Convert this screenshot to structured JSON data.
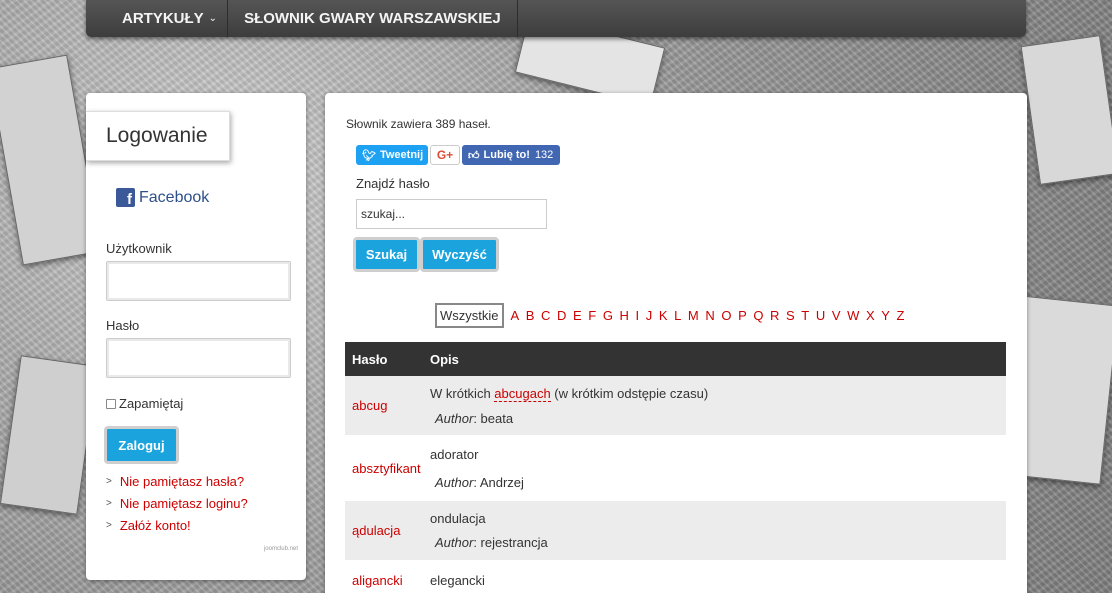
{
  "nav": {
    "items": [
      {
        "label": "ARTYKUŁY",
        "caret": "⌄"
      },
      {
        "label": "SŁOWNIK GWARY WARSZAWSKIEJ"
      }
    ]
  },
  "sidebar": {
    "title": "Logowanie",
    "facebook_label": "Facebook",
    "username_label": "Użytkownik",
    "password_label": "Hasło",
    "remember_label": "Zapamiętaj",
    "login_button": "Zaloguj",
    "links": [
      "Nie pamiętasz hasła?",
      "Nie pamiętasz loginu?",
      "Załóż konto!"
    ],
    "credit": "joomclub.net"
  },
  "main": {
    "count_text": "Słownik zawiera 389 haseł.",
    "social": {
      "tweet": "Tweetnij",
      "gplus": "G+",
      "like": "Lubię to!",
      "like_count": "132"
    },
    "find_label": "Znajdź hasło",
    "search_placeholder": "szukaj...",
    "search_button": "Szukaj",
    "clear_button": "Wyczyść",
    "all_button": "Wszystkie",
    "letters": [
      "A",
      "B",
      "C",
      "D",
      "E",
      "F",
      "G",
      "H",
      "I",
      "J",
      "K",
      "L",
      "M",
      "N",
      "O",
      "P",
      "Q",
      "R",
      "S",
      "T",
      "U",
      "V",
      "W",
      "X",
      "Y",
      "Z"
    ],
    "table": {
      "headers": {
        "term": "Hasło",
        "desc": "Opis"
      },
      "author_prefix": "Author",
      "rows": [
        {
          "term": "abcug",
          "desc_before": "W krótkich ",
          "desc_link": "abcugach",
          "desc_after": " (w krótkim odstępie czasu)",
          "author": "beata"
        },
        {
          "term": "absztyfikant",
          "desc": "adorator",
          "author": "Andrzej"
        },
        {
          "term": "ądulacja",
          "desc": "ondulacja",
          "author": "rejestrancja"
        },
        {
          "term": "aligancki",
          "desc": "elegancki"
        }
      ]
    }
  },
  "colors": {
    "accent": "#1aa3dd",
    "link": "#cc0000",
    "nav": "#444444"
  }
}
